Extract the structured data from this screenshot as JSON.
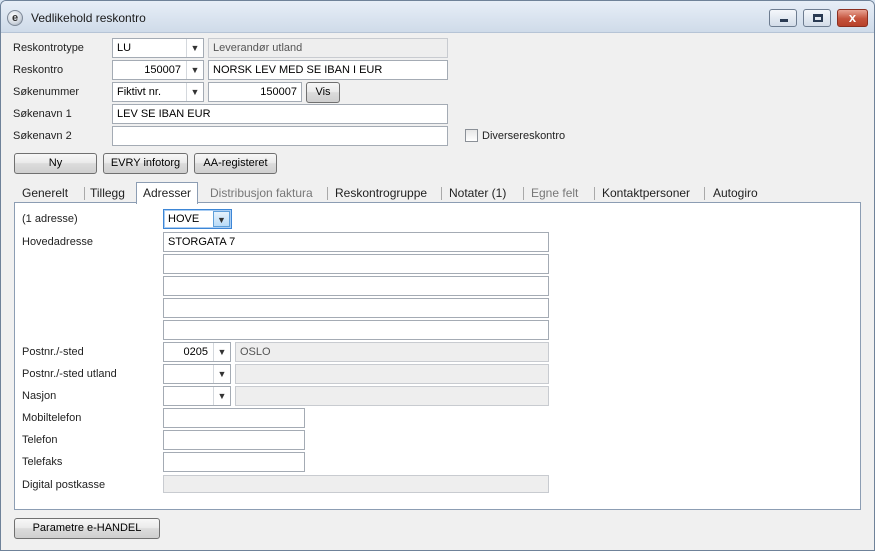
{
  "window": {
    "title": "Vedlikehold reskontro",
    "app_icon": "e",
    "close_glyph": "x"
  },
  "form": {
    "reskontrotype": {
      "label": "Reskontrotype",
      "code": "LU",
      "description": "Leverandør utland"
    },
    "reskontro": {
      "label": "Reskontro",
      "number": "150007",
      "name": "NORSK LEV MED SE IBAN I EUR"
    },
    "sokenummer": {
      "label": "Søkenummer",
      "type": "Fiktivt nr.",
      "number": "150007",
      "vis_button": "Vis"
    },
    "sokenavn1": {
      "label": "Søkenavn 1",
      "value": "LEV SE IBAN EUR"
    },
    "sokenavn2": {
      "label": "Søkenavn 2",
      "value": ""
    },
    "diverse": {
      "label": "Diversereskontro",
      "checked": false
    }
  },
  "buttons": {
    "ny": "Ny",
    "evry": "EVRY infotorg",
    "aa": "AA-registeret",
    "parametre": "Parametre e-HANDEL"
  },
  "tabs": [
    {
      "label": "Generelt",
      "active": false,
      "dim": false
    },
    {
      "label": "Tillegg",
      "active": false,
      "dim": false
    },
    {
      "label": "Adresser",
      "active": true,
      "dim": false
    },
    {
      "label": "Distribusjon faktura",
      "active": false,
      "dim": true
    },
    {
      "label": "Reskontrogruppe",
      "active": false,
      "dim": false
    },
    {
      "label": "Notater (1)",
      "active": false,
      "dim": false
    },
    {
      "label": "Egne felt",
      "active": false,
      "dim": true
    },
    {
      "label": "Kontaktpersoner",
      "active": false,
      "dim": false
    },
    {
      "label": "Autogiro",
      "active": false,
      "dim": false
    }
  ],
  "address": {
    "count_label": "(1 adresse)",
    "type_value": "HOVE",
    "hovedadresse_label": "Hovedadresse",
    "lines": [
      "STORGATA 7",
      "",
      "",
      "",
      ""
    ],
    "postnr_label": "Postnr./-sted",
    "postnr": "0205",
    "poststed": "OSLO",
    "postnr_utland_label": "Postnr./-sted utland",
    "postnr_utland": "",
    "poststed_utland": "",
    "nasjon_label": "Nasjon",
    "nasjon": "",
    "nasjon_name": "",
    "mobil_label": "Mobiltelefon",
    "mobil": "",
    "telefon_label": "Telefon",
    "telefon": "",
    "telefaks_label": "Telefaks",
    "telefaks": "",
    "digital_label": "Digital postkasse",
    "digital": ""
  },
  "icons": {
    "minimize": "minimize-icon",
    "maximize": "maximize-icon",
    "close": "close-icon",
    "dropdown": "chevron-down-icon"
  }
}
